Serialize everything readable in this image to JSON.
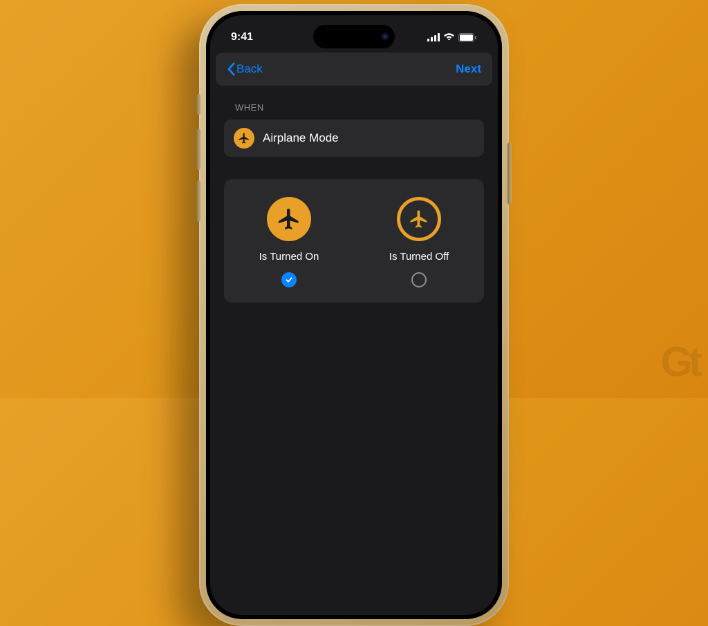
{
  "status_bar": {
    "time": "9:41"
  },
  "nav": {
    "back_label": "Back",
    "next_label": "Next"
  },
  "trigger": {
    "section_header": "WHEN",
    "name": "Airplane Mode"
  },
  "options": {
    "on": {
      "label": "Is Turned On",
      "selected": true
    },
    "off": {
      "label": "Is Turned Off",
      "selected": false
    }
  },
  "watermark": "Gt",
  "colors": {
    "accent": "#0a84ff",
    "airplane": "#e8a028"
  }
}
